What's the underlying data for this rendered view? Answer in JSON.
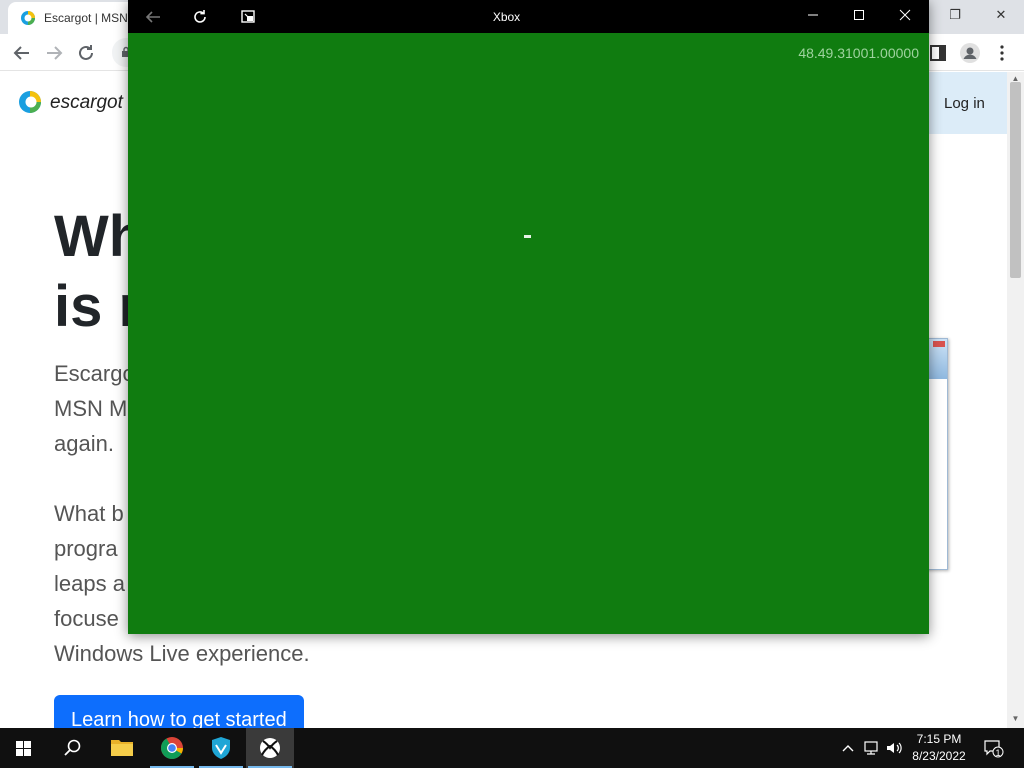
{
  "browser": {
    "tab_title": "Escargot | MSN",
    "window_controls": {
      "restore": "❐",
      "close": "✕"
    }
  },
  "page": {
    "logo_text": "escargot",
    "login_label": "Log in",
    "hero_lines": [
      "Wh",
      "is n"
    ],
    "paragraph1": [
      "Escargo",
      "MSN M",
      "again."
    ],
    "paragraph2": [
      "What b",
      "progra",
      "leaps a",
      "focuse",
      "Windows Live experience."
    ],
    "cta_label": "Learn how to get started"
  },
  "xbox": {
    "title": "Xbox",
    "version": "48.49.31001.00000",
    "accent": "#107c10",
    "titlebar_color": "#000000"
  },
  "taskbar": {
    "time": "7:15 PM",
    "date": "8/23/2022",
    "notification_count": "1",
    "pinned": [
      "start-icon",
      "search-icon",
      "file-explorer-icon",
      "chrome-icon",
      "vpn-shield-icon",
      "xbox-icon"
    ]
  }
}
